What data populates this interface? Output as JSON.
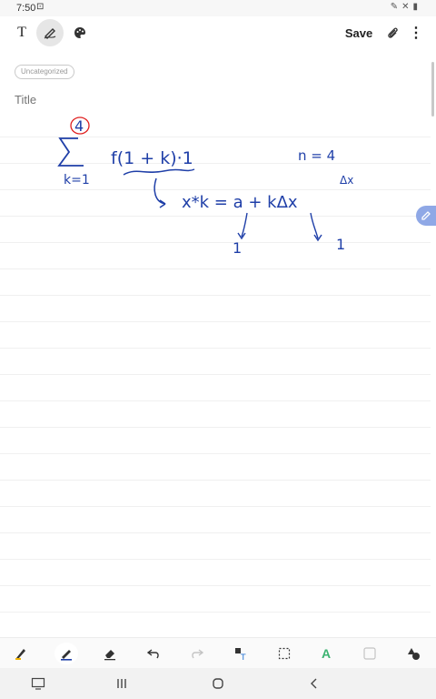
{
  "status_bar": {
    "time": "7:50",
    "screen_icon": "screenshot-icon",
    "right_icons": [
      "pen-icon",
      "silent-icon",
      "battery-icon"
    ]
  },
  "toolbar": {
    "text_mode_label": "T",
    "save_label": "Save",
    "icons": [
      "text-icon",
      "pen-mode-icon",
      "palette-icon",
      "attach-icon",
      "more-icon"
    ]
  },
  "note": {
    "category": "Uncategorized",
    "title_placeholder": "Title",
    "title_value": ""
  },
  "handwriting": {
    "sum_upper": "4",
    "sum_lower": "k=1",
    "summand": "f(1 + k)·1",
    "n_label": "n = 4",
    "dx_label": "Δx",
    "xk_expr": "x*k = a + kΔx",
    "a_value": "1",
    "dx_value": "1"
  },
  "colors": {
    "ink_blue": "#1f3fa8",
    "ink_red": "#e02020",
    "float_pen_bg": "#8fa8e6",
    "accent_green": "#3cb371"
  },
  "bottom_tools": [
    "highlighter-icon",
    "pen-icon",
    "eraser-icon",
    "undo-icon",
    "redo-icon",
    "text-convert-icon",
    "selection-icon",
    "shape-fill-icon",
    "shape-icon",
    "shapes-icon"
  ],
  "nav_bar": [
    "screenshot-nav-icon",
    "recents-icon",
    "home-icon",
    "back-icon"
  ]
}
